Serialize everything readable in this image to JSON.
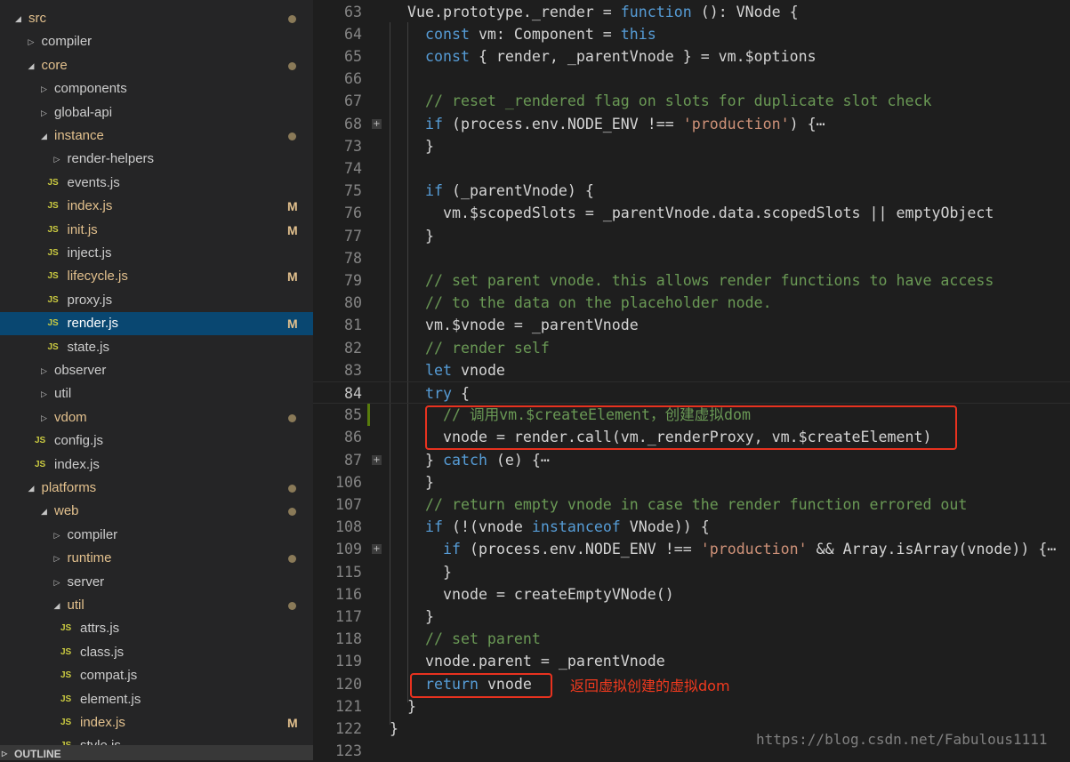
{
  "sidebar": {
    "tree": [
      {
        "label": "src",
        "depth": 0,
        "type": "open",
        "modified": true,
        "dot": true
      },
      {
        "label": "compiler",
        "depth": 1,
        "type": "closed"
      },
      {
        "label": "core",
        "depth": 1,
        "type": "open",
        "modified": true,
        "dot": true
      },
      {
        "label": "components",
        "depth": 2,
        "type": "closed"
      },
      {
        "label": "global-api",
        "depth": 2,
        "type": "closed"
      },
      {
        "label": "instance",
        "depth": 2,
        "type": "open",
        "modified": true,
        "dot": true
      },
      {
        "label": "render-helpers",
        "depth": 3,
        "type": "closed"
      },
      {
        "label": "events.js",
        "depth": 3,
        "type": "file"
      },
      {
        "label": "index.js",
        "depth": 3,
        "type": "file",
        "modified": true,
        "badge": "M"
      },
      {
        "label": "init.js",
        "depth": 3,
        "type": "file",
        "modified": true,
        "badge": "M"
      },
      {
        "label": "inject.js",
        "depth": 3,
        "type": "file"
      },
      {
        "label": "lifecycle.js",
        "depth": 3,
        "type": "file",
        "modified": true,
        "badge": "M"
      },
      {
        "label": "proxy.js",
        "depth": 3,
        "type": "file"
      },
      {
        "label": "render.js",
        "depth": 3,
        "type": "file",
        "selected": true,
        "badge": "M"
      },
      {
        "label": "state.js",
        "depth": 3,
        "type": "file"
      },
      {
        "label": "observer",
        "depth": 2,
        "type": "closed"
      },
      {
        "label": "util",
        "depth": 2,
        "type": "closed"
      },
      {
        "label": "vdom",
        "depth": 2,
        "type": "closed",
        "modified": true,
        "dot": true
      },
      {
        "label": "config.js",
        "depth": 2,
        "type": "file"
      },
      {
        "label": "index.js",
        "depth": 2,
        "type": "file"
      },
      {
        "label": "platforms",
        "depth": 1,
        "type": "open",
        "modified": true,
        "dot": true
      },
      {
        "label": "web",
        "depth": 2,
        "type": "open",
        "modified": true,
        "dot": true
      },
      {
        "label": "compiler",
        "depth": 3,
        "type": "closed"
      },
      {
        "label": "runtime",
        "depth": 3,
        "type": "closed",
        "modified": true,
        "dot": true
      },
      {
        "label": "server",
        "depth": 3,
        "type": "closed"
      },
      {
        "label": "util",
        "depth": 3,
        "type": "open",
        "modified": true,
        "dot": true
      },
      {
        "label": "attrs.js",
        "depth": 4,
        "type": "file"
      },
      {
        "label": "class.js",
        "depth": 4,
        "type": "file"
      },
      {
        "label": "compat.js",
        "depth": 4,
        "type": "file"
      },
      {
        "label": "element.js",
        "depth": 4,
        "type": "file"
      },
      {
        "label": "index.js",
        "depth": 4,
        "type": "file",
        "modified": true,
        "badge": "M"
      },
      {
        "label": "style.js",
        "depth": 4,
        "type": "file"
      }
    ],
    "file_icon_text": "JS",
    "outline_label": "OUTLINE"
  },
  "editor": {
    "current_line": 84,
    "lines": [
      {
        "n": "63",
        "i": 1,
        "t": [
          [
            "d",
            "Vue.prototype._render = "
          ],
          [
            "k",
            "function"
          ],
          [
            "d",
            " (): VNode {"
          ]
        ]
      },
      {
        "n": "64",
        "i": 2,
        "t": [
          [
            "k",
            "const"
          ],
          [
            "d",
            " vm: Component = "
          ],
          [
            "k",
            "this"
          ]
        ]
      },
      {
        "n": "65",
        "i": 2,
        "t": [
          [
            "k",
            "const"
          ],
          [
            "d",
            " { render, _parentVnode } = vm.$options"
          ]
        ]
      },
      {
        "n": "66",
        "i": 0,
        "t": []
      },
      {
        "n": "67",
        "i": 2,
        "t": [
          [
            "c",
            "// reset _rendered flag on slots for duplicate slot check"
          ]
        ]
      },
      {
        "n": "68",
        "i": 2,
        "fold": true,
        "t": [
          [
            "k",
            "if"
          ],
          [
            "d",
            " (process.env.NODE_ENV !== "
          ],
          [
            "s",
            "'production'"
          ],
          [
            "d",
            ") {⋯"
          ]
        ]
      },
      {
        "n": "73",
        "i": 2,
        "t": [
          [
            "d",
            "}"
          ]
        ]
      },
      {
        "n": "74",
        "i": 0,
        "t": []
      },
      {
        "n": "75",
        "i": 2,
        "t": [
          [
            "k",
            "if"
          ],
          [
            "d",
            " (_parentVnode) {"
          ]
        ]
      },
      {
        "n": "76",
        "i": 3,
        "t": [
          [
            "d",
            "vm.$scopedSlots = _parentVnode.data.scopedSlots || emptyObject"
          ]
        ]
      },
      {
        "n": "77",
        "i": 2,
        "t": [
          [
            "d",
            "}"
          ]
        ]
      },
      {
        "n": "78",
        "i": 0,
        "t": []
      },
      {
        "n": "79",
        "i": 2,
        "t": [
          [
            "c",
            "// set parent vnode. this allows render functions to have access"
          ]
        ]
      },
      {
        "n": "80",
        "i": 2,
        "t": [
          [
            "c",
            "// to the data on the placeholder node."
          ]
        ]
      },
      {
        "n": "81",
        "i": 2,
        "t": [
          [
            "d",
            "vm.$vnode = _parentVnode"
          ]
        ]
      },
      {
        "n": "82",
        "i": 2,
        "t": [
          [
            "c",
            "// render self"
          ]
        ]
      },
      {
        "n": "83",
        "i": 2,
        "t": [
          [
            "k",
            "let"
          ],
          [
            "d",
            " vnode"
          ]
        ]
      },
      {
        "n": "84",
        "i": 2,
        "t": [
          [
            "k",
            "try"
          ],
          [
            "d",
            " {"
          ]
        ]
      },
      {
        "n": "85",
        "i": 3,
        "git": true,
        "t": [
          [
            "c",
            "// 调用vm.$createElement，创建虚拟dom"
          ]
        ]
      },
      {
        "n": "86",
        "i": 3,
        "t": [
          [
            "d",
            "vnode = render.call(vm._renderProxy, vm.$createElement)"
          ]
        ]
      },
      {
        "n": "87",
        "i": 2,
        "fold": true,
        "t": [
          [
            "d",
            "} "
          ],
          [
            "k",
            "catch"
          ],
          [
            "d",
            " (e) {⋯"
          ]
        ]
      },
      {
        "n": "106",
        "i": 2,
        "t": [
          [
            "d",
            "}"
          ]
        ]
      },
      {
        "n": "107",
        "i": 2,
        "t": [
          [
            "c",
            "// return empty vnode in case the render function errored out"
          ]
        ]
      },
      {
        "n": "108",
        "i": 2,
        "t": [
          [
            "k",
            "if"
          ],
          [
            "d",
            " (!(vnode "
          ],
          [
            "k",
            "instanceof"
          ],
          [
            "d",
            " VNode)) {"
          ]
        ]
      },
      {
        "n": "109",
        "i": 3,
        "fold": true,
        "t": [
          [
            "k",
            "if"
          ],
          [
            "d",
            " (process.env.NODE_ENV !== "
          ],
          [
            "s",
            "'production'"
          ],
          [
            "d",
            " && Array.isArray(vnode)) {⋯"
          ]
        ]
      },
      {
        "n": "115",
        "i": 3,
        "t": [
          [
            "d",
            "}"
          ]
        ]
      },
      {
        "n": "116",
        "i": 3,
        "t": [
          [
            "d",
            "vnode = createEmptyVNode()"
          ]
        ]
      },
      {
        "n": "117",
        "i": 2,
        "t": [
          [
            "d",
            "}"
          ]
        ]
      },
      {
        "n": "118",
        "i": 2,
        "t": [
          [
            "c",
            "// set parent"
          ]
        ]
      },
      {
        "n": "119",
        "i": 2,
        "t": [
          [
            "d",
            "vnode.parent = _parentVnode"
          ]
        ]
      },
      {
        "n": "120",
        "i": 2,
        "t": [
          [
            "k",
            "return"
          ],
          [
            "d",
            " vnode"
          ]
        ]
      },
      {
        "n": "121",
        "i": 1,
        "t": [
          [
            "d",
            "}"
          ]
        ]
      },
      {
        "n": "122",
        "i": 0,
        "t": [
          [
            "d",
            "}"
          ]
        ]
      },
      {
        "n": "123",
        "i": 0,
        "t": []
      }
    ]
  },
  "annotations": {
    "note": "返回虚拟创建的虚拟dom",
    "color": "#e8321f"
  },
  "watermark": "https://blog.csdn.net/Fabulous1111",
  "colors": {
    "keyword": "#569cd6",
    "string": "#ce9178",
    "comment": "#6a9955",
    "modified": "#e2c08d",
    "selection": "#094771"
  }
}
